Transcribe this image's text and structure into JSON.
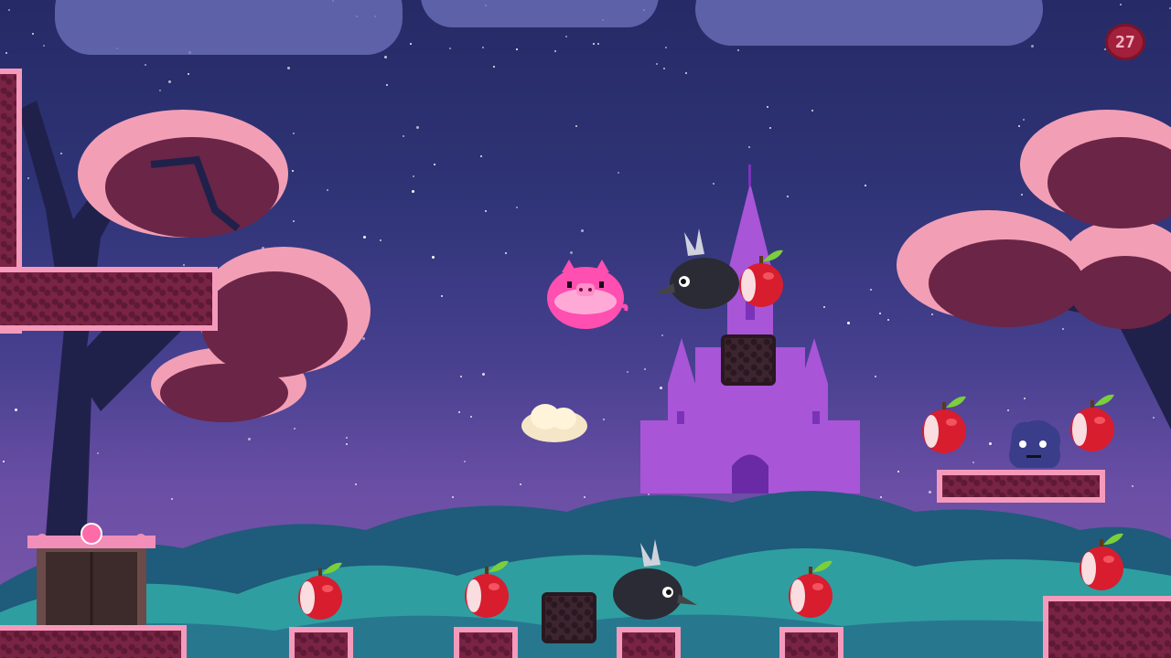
{
  "hud": {
    "counter_value": "27"
  },
  "scene": {
    "apples": [
      {
        "name": "apple-1"
      },
      {
        "name": "apple-2"
      },
      {
        "name": "apple-3"
      },
      {
        "name": "apple-4"
      },
      {
        "name": "apple-5"
      },
      {
        "name": "apple-6"
      },
      {
        "name": "apple-7"
      },
      {
        "name": "apple-8"
      }
    ],
    "colors": {
      "sky_top": "#262a66",
      "sky_bottom": "#7c58a9",
      "platform_edge": "#f59abb",
      "platform_fill": "#7a2445",
      "castle": "#a855d8",
      "hills": "#2f9ea0",
      "pig": "#ff4fb0",
      "apple": "#d81d2e"
    }
  }
}
